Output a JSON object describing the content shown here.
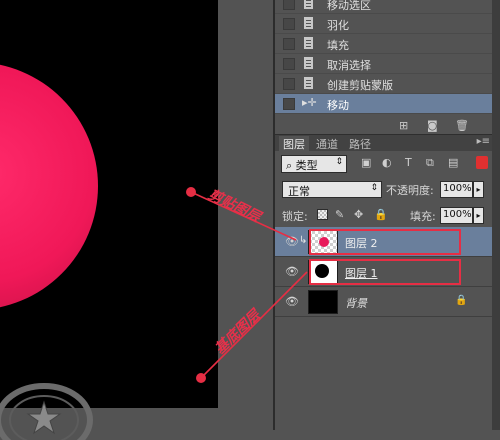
{
  "history": {
    "items": [
      {
        "label": "移动选区",
        "icon": "document-icon"
      },
      {
        "label": "羽化",
        "icon": "document-icon"
      },
      {
        "label": "填充",
        "icon": "document-icon"
      },
      {
        "label": "取消选择",
        "icon": "document-icon"
      },
      {
        "label": "创建剪贴蒙版",
        "icon": "document-icon"
      },
      {
        "label": "移动",
        "icon": "move-tool-icon"
      }
    ],
    "selected_index": 5
  },
  "layers_panel": {
    "tabs": [
      "图层",
      "通道",
      "路径"
    ],
    "active_tab": "图层",
    "filter_kind": "类型",
    "blend_mode": "正常",
    "opacity_label": "不透明度:",
    "opacity_value": "100%",
    "lock_label": "锁定:",
    "fill_label": "填充:",
    "fill_value": "100%",
    "layers": [
      {
        "name": "图层 2",
        "clipped": true,
        "selected": true,
        "thumb": "transparent-with-pink-dot"
      },
      {
        "name": "图层 1",
        "clipped": false,
        "selected": false,
        "thumb": "black-circle-on-white"
      },
      {
        "name": "背景",
        "clipped": false,
        "selected": false,
        "thumb": "black",
        "locked": true
      }
    ]
  },
  "annotations": {
    "top_label": "剪贴图层",
    "bottom_label": "基底图层",
    "color": "#e62e44"
  },
  "colors": {
    "canvas_bg": "#000000",
    "circle": "#f01858",
    "panel_bg": "#535353",
    "selection": "#6a7f9c"
  }
}
